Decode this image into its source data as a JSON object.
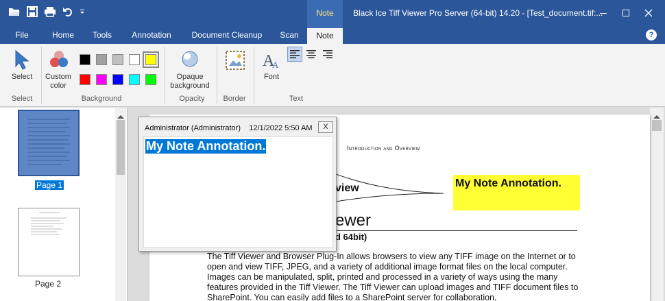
{
  "titlebar": {
    "title": "Black Ice Tiff Viewer Pro Server (64-bit) 14.20 - [Test_document.tif:...",
    "context_tab": "Note",
    "qat_icons": [
      "open-folder-icon",
      "save-icon",
      "print-icon",
      "undo-icon",
      "customize-qat-icon"
    ],
    "window_controls": [
      "minimize-icon",
      "maximize-icon",
      "close-icon"
    ]
  },
  "tabs": [
    "File",
    "Home",
    "Tools",
    "Annotation",
    "Document Cleanup",
    "Scan",
    "Note"
  ],
  "active_tab": "Note",
  "ribbon": {
    "select": {
      "label": "Select",
      "group": "Select"
    },
    "background": {
      "custom_color_label_1": "Custom",
      "custom_color_label_2": "color",
      "group": "Background",
      "swatches": [
        "#000000",
        "#a0a0a0",
        "#c0c0c0",
        "#ffffff",
        "#ffff00",
        "#ff0000",
        "#ff00ff",
        "#0000ff",
        "#00ffff",
        "#00ff00"
      ],
      "selected_swatch": "#ffff00"
    },
    "opacity": {
      "label_1": "Opaque",
      "label_2": "background",
      "group": "Opacity"
    },
    "border": {
      "group": "Border"
    },
    "text": {
      "font_label": "Font",
      "group": "Text",
      "align_buttons": [
        "align-left-icon",
        "align-center-icon",
        "align-right-icon"
      ],
      "active_align": "align-left-icon"
    }
  },
  "thumbnails": [
    {
      "label": "Page 1",
      "selected": true
    },
    {
      "label": "Page 2",
      "selected": false
    }
  ],
  "document": {
    "heading_small": "Introduction and Overview",
    "view_word": "view",
    "viewer_word": "ewer",
    "bit_line": "d 64bit)",
    "paragraph": "The Tiff Viewer and Browser Plug-In allows browsers to view any TIFF image on the Internet or to open and view TIFF, JPEG, and a variety of additional image format files on the local computer.  Images can be manipulated, split, printed and processed in a variety of ways using the many features provided in the Tiff Viewer. The Tiff Viewer can upload images and TIFF document files to SharePoint. You can easily add files to a SharePoint server for collaboration,"
  },
  "annotation": {
    "sticky_text": "My Note Annotation.",
    "sticky_color": "#ffff33"
  },
  "popup": {
    "author": "Administrator (Administrator)",
    "timestamp": "12/1/2022 5:50 AM",
    "close_label": "X",
    "text": "My Note Annotation."
  }
}
